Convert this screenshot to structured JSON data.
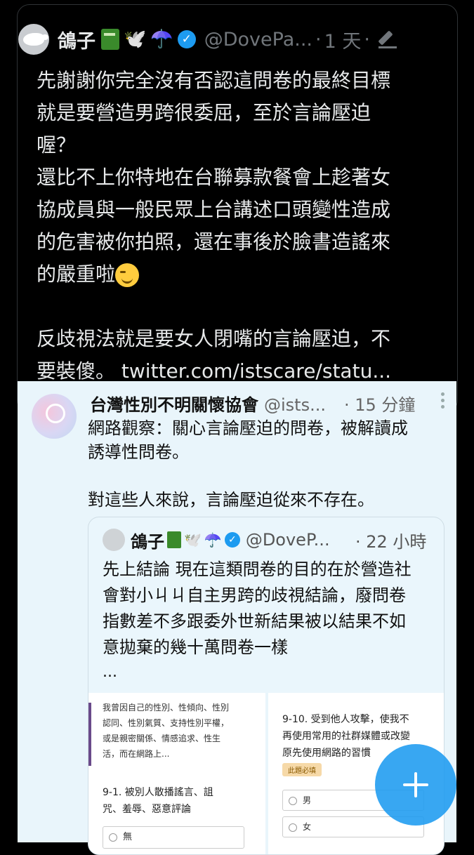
{
  "tweet": {
    "author_name": "鴿子",
    "author_emojis": [
      "🕊️",
      "☂️"
    ],
    "verified_mark": "✓",
    "handle": "@DovePa...",
    "separator": "·",
    "time": "1 天",
    "body": "先謝謝你完全沒有否認這問卷的最終目標\n就是要營造男跨很委屈，至於言論壓迫\n喔？\n還比不上你特地在台聯募款餐會上趁著女\n協成員與一般民眾上台講述口頭變性造成\n的危害被你拍照，還在事後於臉書造謠來\n的嚴重啦",
    "body_after": "\n\n反歧視法就是要女人閉嘴的言論壓迫，不\n要裝傻。 ",
    "link": "twitter.com/istscare/statu..."
  },
  "quoted_tweet": {
    "author_name": "台灣性別不明關懷協會",
    "handle": "@ists...",
    "time": "· 15 分鐘",
    "text": "網路觀察：關心言論壓迫的問卷，被解讀成\n誘導性問卷。\n\n對這些人來說，言論壓迫從來不存在。"
  },
  "inner_tweet": {
    "author_name": "鴿子",
    "emojis": [
      "🕊️",
      "☂️"
    ],
    "verified_mark": "✓",
    "handle": "@DoveP...",
    "time": "· 22 小時",
    "text": "先上結論 現在這類問卷的目的在於營造社\n會對小ㄐㄐ自主男跨的歧視結論，廢問卷\n指數差不多跟委外世新結果被以結果不如\n意拋棄的幾十萬問卷一樣",
    "ellipsis": "..."
  },
  "form_left": {
    "description": "我曾因自己的性別、性傾向、性別\n認同、性別氣質、支持性別平權，\n或是親密關係、情感追求、性生\n活，而在網路上...",
    "question": "9-1. 被別人散播謠言、詛\n咒、羞辱、惡意評論",
    "option": "無"
  },
  "form_right": {
    "question": "9-10. 受到他人攻擊，使我不\n再使用常用的社群媒體或改變\n原先使用網路的習慣",
    "required_tag": "此題必填",
    "option_male": "男",
    "option_female": "女"
  },
  "fab": {
    "icon": "plus-icon"
  },
  "colors": {
    "accent": "#1d9bf0",
    "background": "#000000",
    "quote_bg": "#e9f5fb"
  }
}
